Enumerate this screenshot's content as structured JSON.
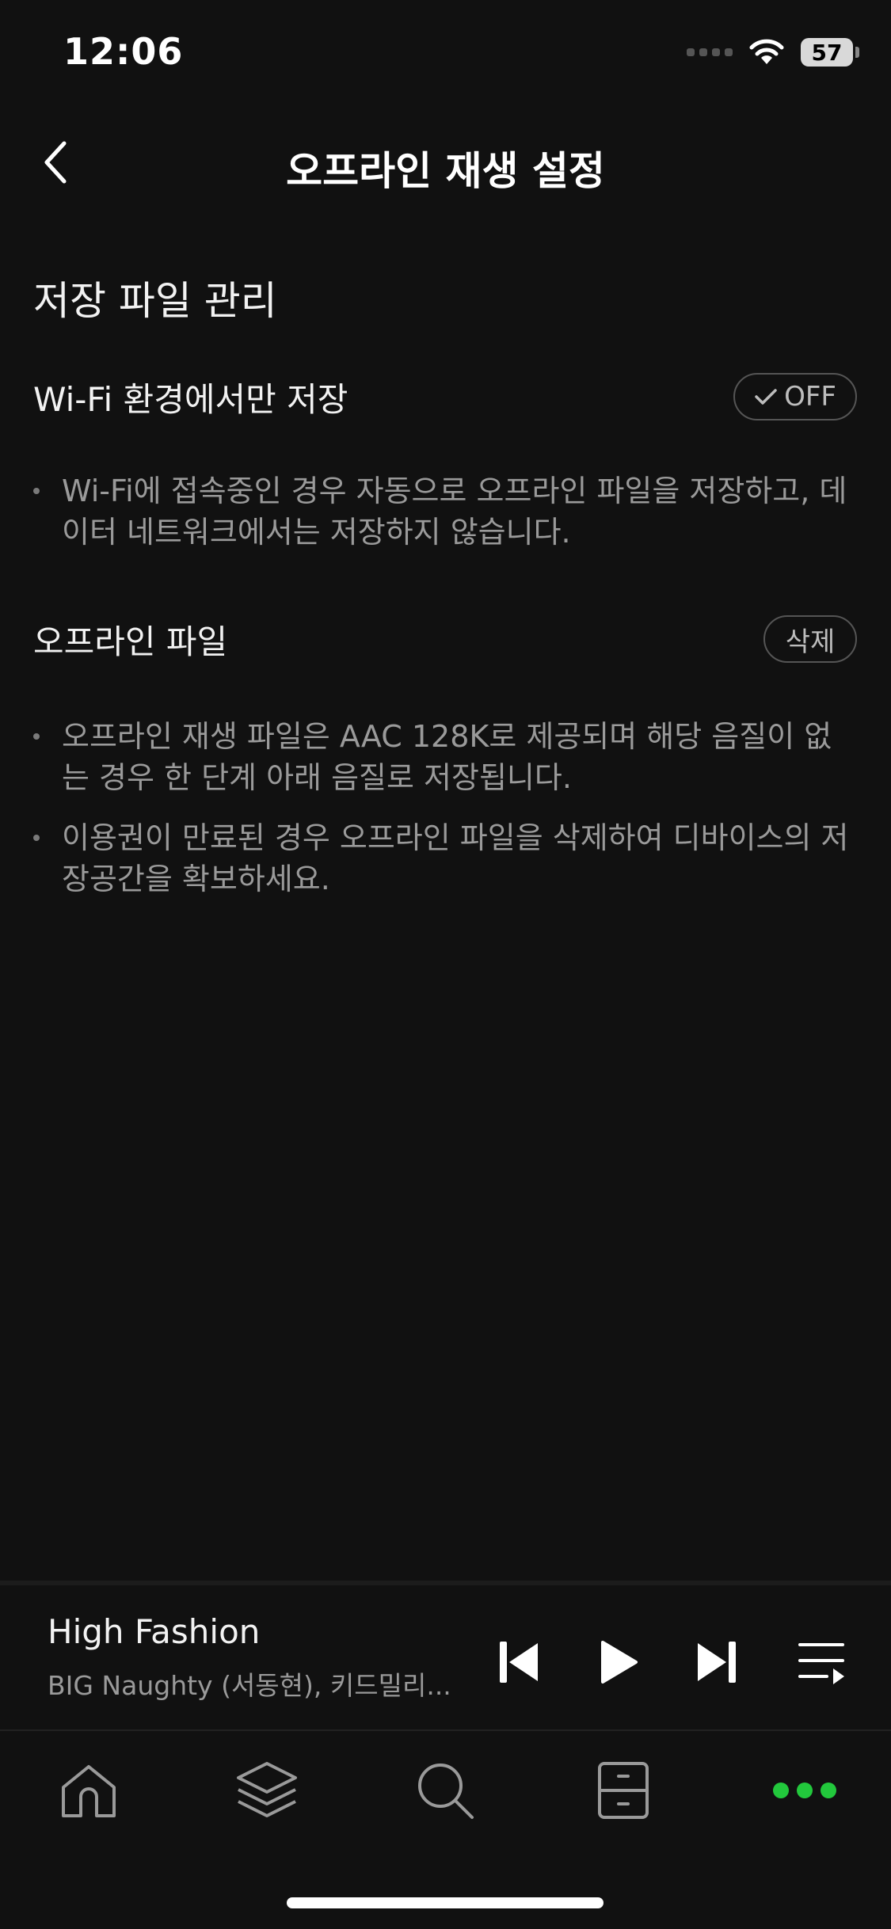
{
  "status_bar": {
    "time": "12:06",
    "battery": "57"
  },
  "header": {
    "title": "오프라인 재생 설정"
  },
  "section": {
    "title": "저장 파일 관리"
  },
  "wifi_setting": {
    "label": "Wi-Fi 환경에서만 저장",
    "toggle_label": "OFF",
    "note": "Wi-Fi에 접속중인 경우 자동으로 오프라인 파일을 저장하고, 데이터 네트워크에서는 저장하지 않습니다."
  },
  "offline_files": {
    "label": "오프라인 파일",
    "delete_label": "삭제",
    "notes": [
      "오프라인 재생 파일은 AAC 128K로 제공되며 해당 음질이 없는 경우 한 단계 아래 음질로 저장됩니다.",
      "이용권이 만료된 경우 오프라인 파일을 삭제하여 디바이스의 저장공간을 확보하세요."
    ]
  },
  "player": {
    "title": "High Fashion",
    "artist": "BIG Naughty (서동현), 키드밀리..."
  },
  "colors": {
    "background": "#111111",
    "accent": "#22c83c",
    "muted_text": "#9a9a9a"
  },
  "tab_bar": {
    "tabs": [
      {
        "icon": "home-icon"
      },
      {
        "icon": "layers-icon"
      },
      {
        "icon": "search-icon"
      },
      {
        "icon": "drawer-icon"
      },
      {
        "icon": "more-dots-icon",
        "active": true
      }
    ]
  }
}
